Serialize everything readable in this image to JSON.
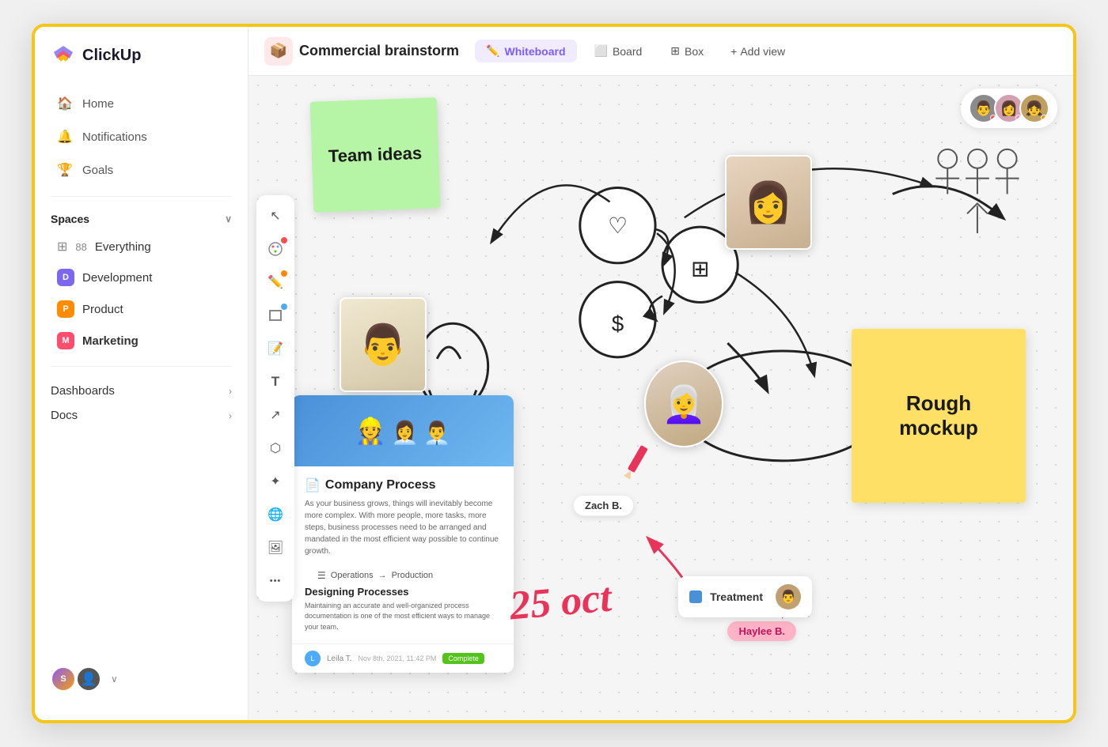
{
  "app": {
    "name": "ClickUp"
  },
  "sidebar": {
    "nav": [
      {
        "id": "home",
        "label": "Home",
        "icon": "🏠"
      },
      {
        "id": "notifications",
        "label": "Notifications",
        "icon": "🔔"
      },
      {
        "id": "goals",
        "label": "Goals",
        "icon": "🏆"
      }
    ],
    "spaces_label": "Spaces",
    "spaces": [
      {
        "id": "everything",
        "label": "Everything",
        "icon": "grid",
        "count": "88",
        "color": null
      },
      {
        "id": "development",
        "label": "Development",
        "badge": "D",
        "color": "#7B68EE"
      },
      {
        "id": "product",
        "label": "Product",
        "badge": "P",
        "color": "#FF8C00"
      },
      {
        "id": "marketing",
        "label": "Marketing",
        "badge": "M",
        "color": "#FF4D6D",
        "bold": true
      }
    ],
    "sections": [
      {
        "id": "dashboards",
        "label": "Dashboards"
      },
      {
        "id": "docs",
        "label": "Docs"
      }
    ],
    "footer": {
      "avatars": [
        "S",
        "👤"
      ]
    }
  },
  "topbar": {
    "project_icon": "📦",
    "project_title": "Commercial brainstorm",
    "tabs": [
      {
        "id": "whiteboard",
        "label": "Whiteboard",
        "icon": "✏️",
        "active": true
      },
      {
        "id": "board",
        "label": "Board",
        "icon": "⬜"
      },
      {
        "id": "box",
        "label": "Box",
        "icon": "⊞"
      },
      {
        "id": "add_view",
        "label": "Add view"
      }
    ]
  },
  "whiteboard": {
    "sticky_green": "Team ideas",
    "sticky_yellow": "Rough mockup",
    "doc_title": "Company Process",
    "doc_desc": "As your business grows, things will inevitably become more complex. With more people, more tasks, more steps, business processes need to be arranged and mandated in the most efficient way possible to continue growth.",
    "doc_flow_from": "Operations",
    "doc_flow_to": "Production",
    "doc_section": "Designing Processes",
    "doc_section_desc": "Maintaining an accurate and well-organized process documentation is one of the most efficient ways to manage your team.",
    "doc_footer_user": "Leila T.",
    "doc_footer_date": "Nov 8th, 2021, 11:42 PM",
    "doc_badge": "Complete",
    "user_labels": [
      {
        "name": "Zach B.",
        "color": "#ff4d6d"
      },
      {
        "name": "Haylee B.",
        "color": "#ff4d6d"
      }
    ],
    "treatment_label": "Treatment",
    "oct_text": "25 oct",
    "people_icons": "ⓟⓟⓟ"
  },
  "toolbar": {
    "tools": [
      {
        "id": "cursor",
        "icon": "↖",
        "dot": null
      },
      {
        "id": "palette",
        "icon": "✨",
        "dot": "#ff4d4f"
      },
      {
        "id": "pen",
        "icon": "✏️",
        "dot": "#ff8800"
      },
      {
        "id": "rectangle",
        "icon": "▢",
        "dot": "#4dabf7"
      },
      {
        "id": "note",
        "icon": "📝",
        "dot": null
      },
      {
        "id": "text",
        "icon": "T",
        "dot": null
      },
      {
        "id": "arrow",
        "icon": "⤴",
        "dot": null
      },
      {
        "id": "network",
        "icon": "⬡",
        "dot": null
      },
      {
        "id": "star",
        "icon": "✦",
        "dot": null
      },
      {
        "id": "globe",
        "icon": "🌐",
        "dot": null
      },
      {
        "id": "image",
        "icon": "🖼",
        "dot": null
      },
      {
        "id": "more",
        "icon": "•••",
        "dot": null
      }
    ]
  }
}
